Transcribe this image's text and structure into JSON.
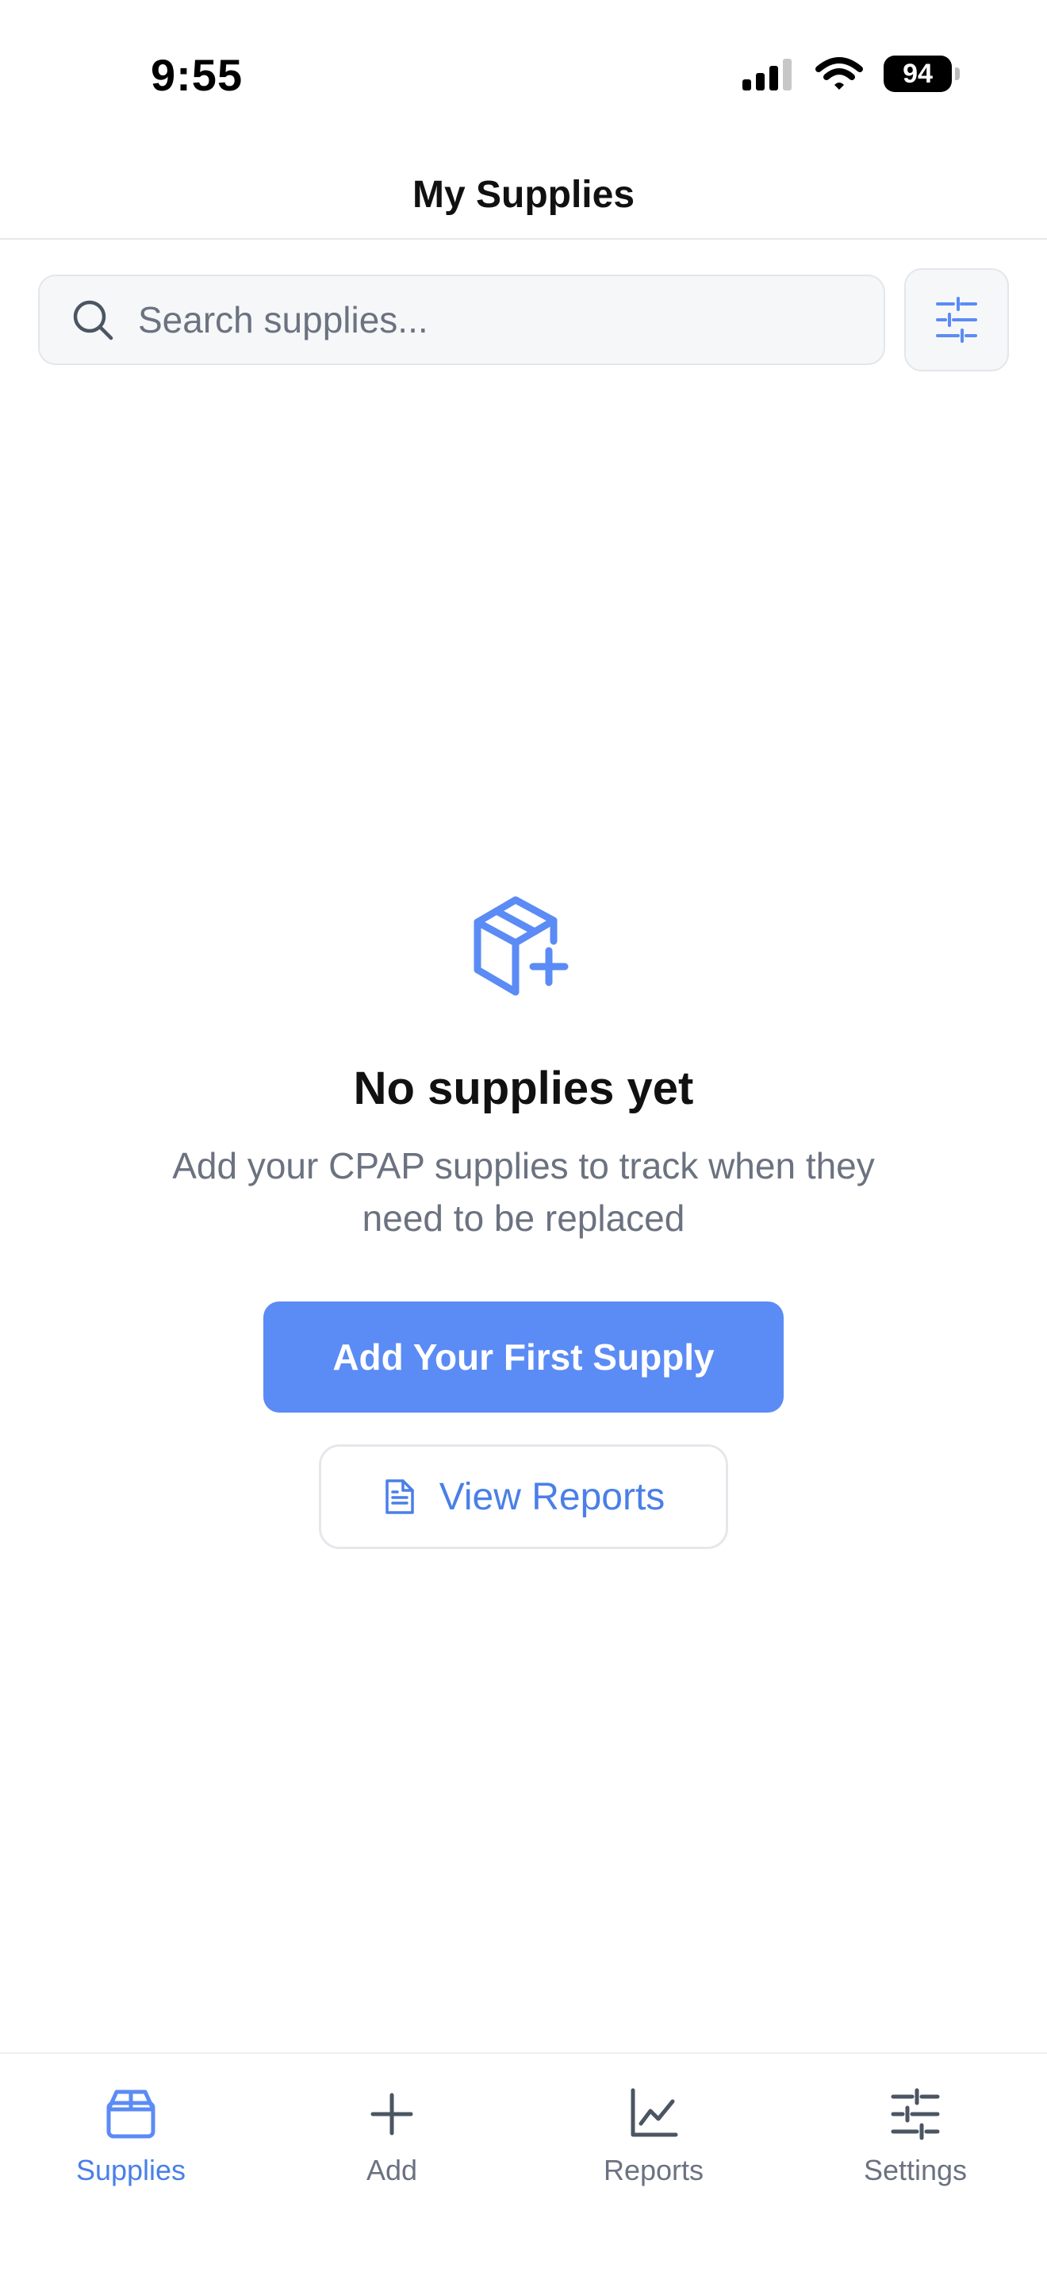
{
  "status_bar": {
    "time": "9:55",
    "battery": "94",
    "icons": [
      "cellular-signal-icon",
      "wifi-icon",
      "battery-icon"
    ]
  },
  "header": {
    "title": "My Supplies"
  },
  "search": {
    "placeholder": "Search supplies...",
    "value": "",
    "icon": "search-icon",
    "filter_icon": "sliders-icon"
  },
  "empty_state": {
    "icon": "package-plus-icon",
    "title": "No supplies yet",
    "description": "Add your CPAP supplies to track when they need to be replaced",
    "primary_button": "Add Your First Supply",
    "secondary_button": "View Reports",
    "secondary_icon": "document-icon"
  },
  "tab_bar": {
    "items": [
      {
        "label": "Supplies",
        "icon": "package-icon",
        "active": true
      },
      {
        "label": "Add",
        "icon": "plus-icon",
        "active": false
      },
      {
        "label": "Reports",
        "icon": "line-chart-icon",
        "active": false
      },
      {
        "label": "Settings",
        "icon": "sliders-icon",
        "active": false
      }
    ]
  },
  "colors": {
    "accent": "#5b8bf5",
    "accent_text": "#4a7fe8",
    "muted_text": "#6b7280",
    "border": "#e5e7eb",
    "input_bg": "#f6f7f9"
  }
}
